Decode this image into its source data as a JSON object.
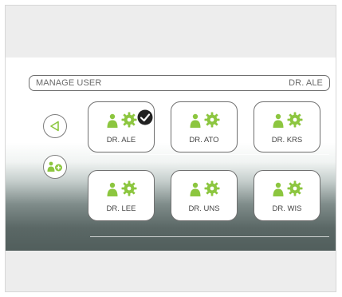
{
  "header": {
    "title": "MANAGE USER",
    "current_user": "DR. ALE"
  },
  "users": [
    {
      "label": "DR. ALE",
      "selected": true
    },
    {
      "label": "DR. ATO",
      "selected": false
    },
    {
      "label": "DR. KRS",
      "selected": false
    },
    {
      "label": "DR. LEE",
      "selected": false
    },
    {
      "label": "DR. UNS",
      "selected": false
    },
    {
      "label": "DR. WIS",
      "selected": false
    }
  ],
  "side_controls": {
    "back_icon": "back-triangle-icon",
    "add_icon": "add-user-icon"
  },
  "colors": {
    "accent_green": "#8cc63f",
    "border": "#6f6f6f",
    "text": "#444444"
  }
}
